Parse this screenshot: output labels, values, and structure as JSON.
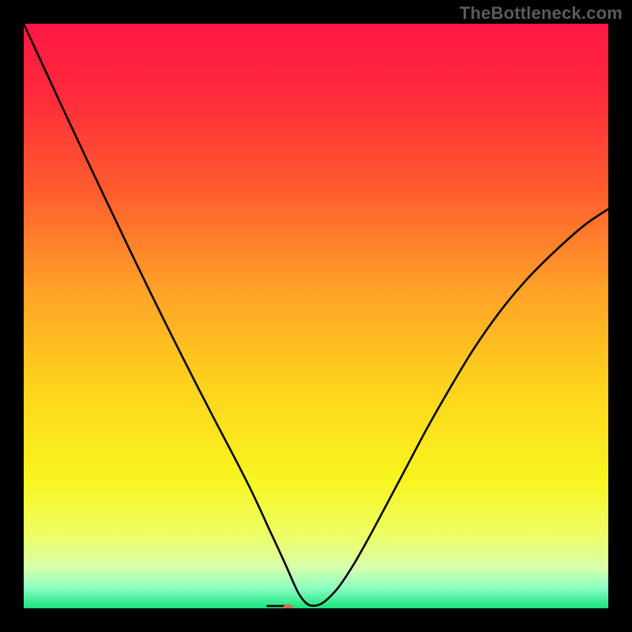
{
  "watermark": "TheBottleneck.com",
  "chart_data": {
    "type": "line",
    "title": "",
    "xlabel": "",
    "ylabel": "",
    "xlim": [
      0,
      100
    ],
    "ylim": [
      0,
      100
    ],
    "grid": false,
    "legend": false,
    "background_gradient_stops": [
      {
        "offset": 0.0,
        "color": "#ff1744"
      },
      {
        "offset": 0.12,
        "color": "#ff2a3c"
      },
      {
        "offset": 0.28,
        "color": "#ff5a2e"
      },
      {
        "offset": 0.45,
        "color": "#ffa028"
      },
      {
        "offset": 0.62,
        "color": "#ffd31c"
      },
      {
        "offset": 0.78,
        "color": "#f8f51f"
      },
      {
        "offset": 0.88,
        "color": "#ecff6a"
      },
      {
        "offset": 0.93,
        "color": "#d8ffae"
      },
      {
        "offset": 0.965,
        "color": "#8dffc3"
      },
      {
        "offset": 1.0,
        "color": "#19e27e"
      }
    ],
    "series": [
      {
        "name": "bottleneck-curve",
        "color": "#000000",
        "x": [
          0,
          3,
          6,
          9,
          12,
          15,
          18,
          21,
          24,
          27,
          30,
          33,
          36,
          38.5,
          40.5,
          42,
          43.5,
          45,
          46,
          47,
          48,
          49,
          50.5,
          52,
          54,
          56.5,
          59,
          62,
          65.5,
          69,
          73,
          77,
          81.5,
          86,
          91,
          96,
          100
        ],
        "y": [
          100,
          93.5,
          87,
          80.6,
          74.2,
          67.9,
          61.6,
          55.4,
          49.3,
          43.3,
          37.4,
          31.6,
          25.9,
          21.0,
          16.8,
          13.5,
          10.3,
          7.0,
          4.7,
          2.6,
          1.2,
          0.5,
          0.6,
          1.6,
          3.8,
          7.6,
          12.0,
          17.6,
          24.2,
          30.8,
          37.8,
          44.4,
          50.8,
          56.2,
          61.2,
          65.6,
          68.3
        ]
      },
      {
        "name": "flat-minimum-segment",
        "color": "#000000",
        "x": [
          41.7,
          45.0
        ],
        "y": [
          0.4,
          0.4
        ]
      }
    ],
    "marker": {
      "name": "optimal-point",
      "x": 45.2,
      "y": 0.0,
      "color": "#d46a4a",
      "rx": 7,
      "ry": 5
    }
  }
}
